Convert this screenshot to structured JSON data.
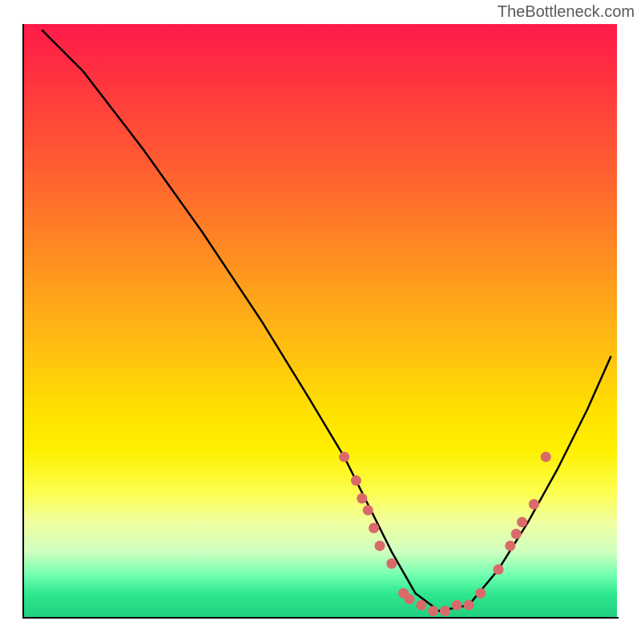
{
  "watermark": "TheBottleneck.com",
  "chart_data": {
    "type": "line",
    "title": "",
    "xlabel": "",
    "ylabel": "",
    "xlim": [
      0,
      100
    ],
    "ylim": [
      0,
      100
    ],
    "series": [
      {
        "name": "bottleneck-curve",
        "x": [
          3,
          10,
          20,
          30,
          40,
          48,
          54,
          58,
          62,
          66,
          70,
          75,
          80,
          85,
          90,
          95,
          99
        ],
        "y": [
          99,
          92,
          79,
          65,
          50,
          37,
          27,
          19,
          11,
          4,
          1,
          2,
          8,
          16,
          25,
          35,
          44
        ],
        "color": "#000000"
      }
    ],
    "points": [
      {
        "name": "dot",
        "x": 54,
        "y": 27,
        "color": "#d96a6a"
      },
      {
        "name": "dot",
        "x": 56,
        "y": 23,
        "color": "#d96a6a"
      },
      {
        "name": "dot",
        "x": 57,
        "y": 20,
        "color": "#d96a6a"
      },
      {
        "name": "dot",
        "x": 58,
        "y": 18,
        "color": "#d96a6a"
      },
      {
        "name": "dot",
        "x": 59,
        "y": 15,
        "color": "#d96a6a"
      },
      {
        "name": "dot",
        "x": 60,
        "y": 12,
        "color": "#d96a6a"
      },
      {
        "name": "dot",
        "x": 62,
        "y": 9,
        "color": "#d96a6a"
      },
      {
        "name": "dot",
        "x": 64,
        "y": 4,
        "color": "#d96a6a"
      },
      {
        "name": "dot",
        "x": 65,
        "y": 3,
        "color": "#d96a6a"
      },
      {
        "name": "dot",
        "x": 67,
        "y": 2,
        "color": "#d96a6a"
      },
      {
        "name": "dot",
        "x": 69,
        "y": 1,
        "color": "#d96a6a"
      },
      {
        "name": "dot",
        "x": 71,
        "y": 1,
        "color": "#d96a6a"
      },
      {
        "name": "dot",
        "x": 73,
        "y": 2,
        "color": "#d96a6a"
      },
      {
        "name": "dot",
        "x": 75,
        "y": 2,
        "color": "#d96a6a"
      },
      {
        "name": "dot",
        "x": 77,
        "y": 4,
        "color": "#d96a6a"
      },
      {
        "name": "dot",
        "x": 80,
        "y": 8,
        "color": "#d96a6a"
      },
      {
        "name": "dot",
        "x": 82,
        "y": 12,
        "color": "#d96a6a"
      },
      {
        "name": "dot",
        "x": 83,
        "y": 14,
        "color": "#d96a6a"
      },
      {
        "name": "dot",
        "x": 84,
        "y": 16,
        "color": "#d96a6a"
      },
      {
        "name": "dot",
        "x": 86,
        "y": 19,
        "color": "#d96a6a"
      },
      {
        "name": "dot",
        "x": 88,
        "y": 27,
        "color": "#d96a6a"
      }
    ]
  }
}
